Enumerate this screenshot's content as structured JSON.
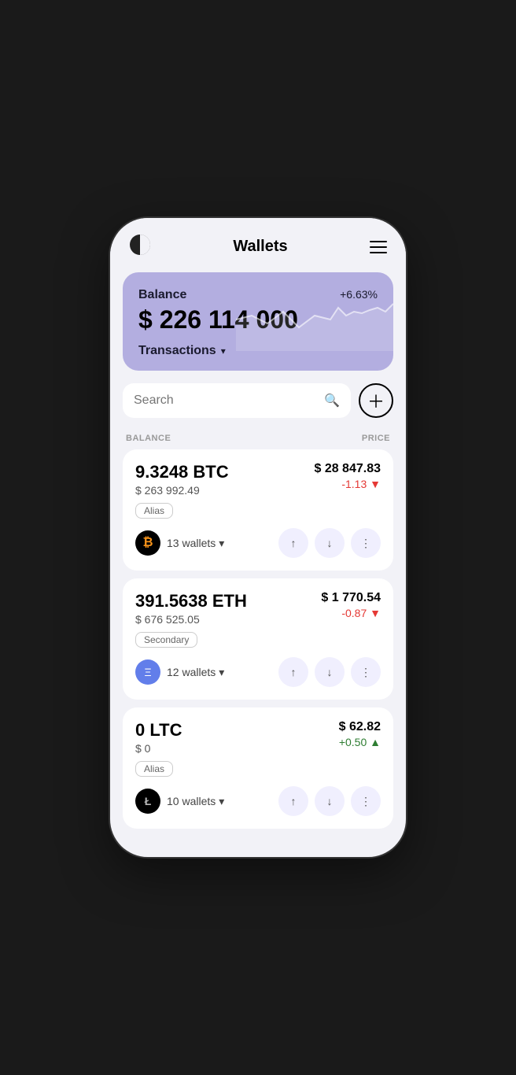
{
  "header": {
    "title": "Wallets",
    "logo": "half-moon-icon",
    "menu": "menu-icon"
  },
  "balance_card": {
    "label": "Balance",
    "percent": "+6.63%",
    "amount": "$ 226 114 000",
    "transactions_label": "Transactions"
  },
  "search": {
    "placeholder": "Search"
  },
  "table_headers": {
    "left": "BALANCE",
    "right": "PRICE"
  },
  "coins": [
    {
      "id": "btc",
      "amount": "9.3248 BTC",
      "usd_value": "$ 263 992.49",
      "tag": "Alias",
      "wallets_count": "13 wallets",
      "price": "$ 28 847.83",
      "change": "-1.13",
      "change_direction": "neg",
      "symbol": "₿"
    },
    {
      "id": "eth",
      "amount": "391.5638 ETH",
      "usd_value": "$ 676 525.05",
      "tag": "Secondary",
      "wallets_count": "12 wallets",
      "price": "$ 1 770.54",
      "change": "-0.87",
      "change_direction": "neg",
      "symbol": "Ξ"
    },
    {
      "id": "ltc",
      "amount": "0 LTC",
      "usd_value": "$ 0",
      "tag": "Alias",
      "wallets_count": "10 wallets",
      "price": "$ 62.82",
      "change": "+0.50",
      "change_direction": "pos",
      "symbol": "Ł"
    }
  ],
  "actions": {
    "send_label": "↑",
    "receive_label": "↓",
    "more_label": "⋮"
  }
}
